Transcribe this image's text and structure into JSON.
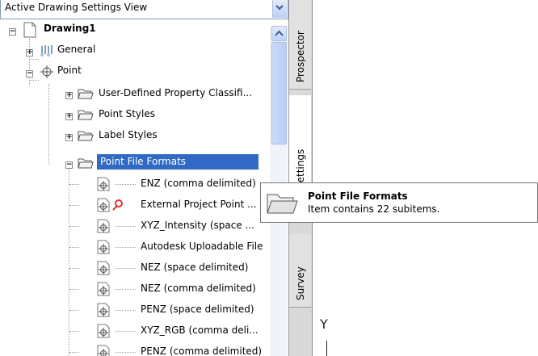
{
  "dropdown": {
    "value": "Active Drawing Settings View"
  },
  "tree": {
    "root": "Drawing1",
    "general": "General",
    "point": "Point",
    "folders": [
      "User-Defined Property Classifi...",
      "Point Styles",
      "Label Styles",
      "Point File Formats"
    ],
    "formats": [
      "ENZ (comma delimited)",
      "External Project Point ...",
      "XYZ_Intensity (space ...",
      "Autodesk Uploadable File",
      "NEZ (space delimited)",
      "NEZ (comma delimited)",
      "PENZ (space delimited)",
      "XYZ_RGB (comma deli...",
      "PENZ (comma delimited)"
    ]
  },
  "tabs": {
    "prospector": "Prospector",
    "settings": "Settings",
    "survey": "Survey"
  },
  "tooltip": {
    "title": "Point File Formats",
    "subtitle": "Item contains 22 subitems."
  },
  "axis": {
    "y": "Y"
  },
  "colors": {
    "selection": "#316ac5",
    "accent_blue": "#7f9db9"
  }
}
